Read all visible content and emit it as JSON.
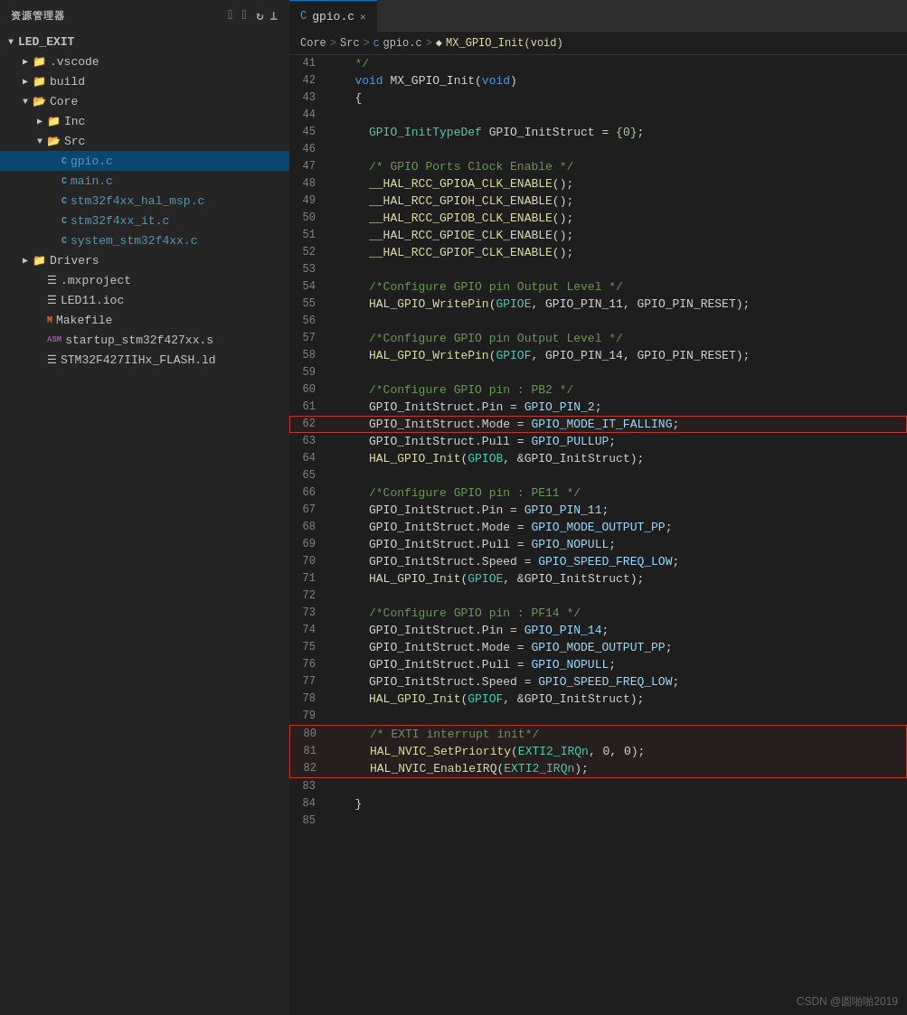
{
  "sidebar": {
    "header": "资源管理器",
    "icons": [
      "⊕",
      "⊟",
      "↻",
      "⊡"
    ],
    "root": "LED_EXIT",
    "items": [
      {
        "id": "vscode",
        "label": ".vscode",
        "type": "folder",
        "depth": 1,
        "open": false
      },
      {
        "id": "build",
        "label": "build",
        "type": "folder",
        "depth": 1,
        "open": false
      },
      {
        "id": "core",
        "label": "Core",
        "type": "folder",
        "depth": 1,
        "open": true
      },
      {
        "id": "inc",
        "label": "Inc",
        "type": "folder",
        "depth": 2,
        "open": false
      },
      {
        "id": "src",
        "label": "Src",
        "type": "folder",
        "depth": 2,
        "open": true
      },
      {
        "id": "gpio",
        "label": "gpio.c",
        "type": "c",
        "depth": 3,
        "active": true
      },
      {
        "id": "main",
        "label": "main.c",
        "type": "c",
        "depth": 3
      },
      {
        "id": "stm32f4xx_hal_msp",
        "label": "stm32f4xx_hal_msp.c",
        "type": "c",
        "depth": 3
      },
      {
        "id": "stm32f4xx_it",
        "label": "stm32f4xx_it.c",
        "type": "c",
        "depth": 3
      },
      {
        "id": "system_stm32f4xx",
        "label": "system_stm32f4xx.c",
        "type": "c",
        "depth": 3
      },
      {
        "id": "drivers",
        "label": "Drivers",
        "type": "folder",
        "depth": 1,
        "open": false
      },
      {
        "id": "mxproject",
        "label": ".mxproject",
        "type": "file",
        "depth": 1
      },
      {
        "id": "led11ioc",
        "label": "LED11.ioc",
        "type": "file",
        "depth": 1
      },
      {
        "id": "makefile",
        "label": "Makefile",
        "type": "makefile",
        "depth": 1
      },
      {
        "id": "startup",
        "label": "startup_stm32f427xx.s",
        "type": "asm",
        "depth": 1
      },
      {
        "id": "stm32flash",
        "label": "STM32F427IIHx_FLASH.ld",
        "type": "ld",
        "depth": 1
      }
    ]
  },
  "tab": {
    "filename": "gpio.c",
    "icon": "C"
  },
  "breadcrumb": {
    "items": [
      "Core",
      "Src",
      "gpio.c",
      "MX_GPIO_Init(void)"
    ]
  },
  "watermark": "CSDN @圆啪啪2019",
  "code": {
    "lines": [
      {
        "n": 41,
        "tokens": [
          {
            "t": "   */",
            "c": "comment"
          }
        ]
      },
      {
        "n": 42,
        "tokens": [
          {
            "t": "   ",
            "c": "plain"
          },
          {
            "t": "void",
            "c": "kw"
          },
          {
            "t": " MX_GPIO_Init(",
            "c": "plain"
          },
          {
            "t": "void",
            "c": "kw"
          },
          {
            "t": ")",
            "c": "plain"
          }
        ]
      },
      {
        "n": 43,
        "tokens": [
          {
            "t": "   {",
            "c": "plain"
          }
        ]
      },
      {
        "n": 44,
        "tokens": []
      },
      {
        "n": 45,
        "tokens": [
          {
            "t": "     ",
            "c": "plain"
          },
          {
            "t": "GPIO_InitTypeDef",
            "c": "type"
          },
          {
            "t": " GPIO_InitStruct = ",
            "c": "plain"
          },
          {
            "t": "{0}",
            "c": "num"
          },
          {
            "t": ";",
            "c": "plain"
          }
        ]
      },
      {
        "n": 46,
        "tokens": []
      },
      {
        "n": 47,
        "tokens": [
          {
            "t": "     ",
            "c": "comment"
          },
          {
            "t": "/* GPIO Ports Clock Enable */",
            "c": "comment"
          }
        ]
      },
      {
        "n": 48,
        "tokens": [
          {
            "t": "     __HAL_RCC_GPIOA_CLK_ENABLE",
            "c": "fn"
          },
          {
            "t": "();",
            "c": "plain"
          }
        ]
      },
      {
        "n": 49,
        "tokens": [
          {
            "t": "     __HAL_RCC_GPIOH_CLK_ENABLE",
            "c": "fn"
          },
          {
            "t": "();",
            "c": "plain"
          }
        ]
      },
      {
        "n": 50,
        "tokens": [
          {
            "t": "     __HAL_RCC_GPIOB_CLK_ENABLE",
            "c": "fn"
          },
          {
            "t": "();",
            "c": "plain"
          }
        ]
      },
      {
        "n": 51,
        "tokens": [
          {
            "t": "     __HAL_RCC_GPIOE_CLK_ENABLE",
            "c": "fn"
          },
          {
            "t": "();",
            "c": "plain"
          }
        ]
      },
      {
        "n": 52,
        "tokens": [
          {
            "t": "     __HAL_RCC_GPIOF_CLK_ENABLE",
            "c": "fn"
          },
          {
            "t": "();",
            "c": "plain"
          }
        ]
      },
      {
        "n": 53,
        "tokens": []
      },
      {
        "n": 54,
        "tokens": [
          {
            "t": "     ",
            "c": "comment"
          },
          {
            "t": "/*Configure GPIO pin Output Level */",
            "c": "comment"
          }
        ]
      },
      {
        "n": 55,
        "tokens": [
          {
            "t": "     ",
            "c": "plain"
          },
          {
            "t": "HAL_GPIO_WritePin",
            "c": "fn"
          },
          {
            "t": "(",
            "c": "plain"
          },
          {
            "t": "GPIOE",
            "c": "cyan-id"
          },
          {
            "t": ", GPIO_PIN_11, GPIO_PIN_RESET);",
            "c": "plain"
          }
        ]
      },
      {
        "n": 56,
        "tokens": []
      },
      {
        "n": 57,
        "tokens": [
          {
            "t": "     ",
            "c": "comment"
          },
          {
            "t": "/*Configure GPIO pin Output Level */",
            "c": "comment"
          }
        ]
      },
      {
        "n": 58,
        "tokens": [
          {
            "t": "     ",
            "c": "plain"
          },
          {
            "t": "HAL_GPIO_WritePin",
            "c": "fn"
          },
          {
            "t": "(",
            "c": "plain"
          },
          {
            "t": "GPIOF",
            "c": "cyan-id"
          },
          {
            "t": ", GPIO_PIN_14, GPIO_PIN_RESET);",
            "c": "plain"
          }
        ]
      },
      {
        "n": 59,
        "tokens": []
      },
      {
        "n": 60,
        "tokens": [
          {
            "t": "     ",
            "c": "comment"
          },
          {
            "t": "/*Configure GPIO pin : PB2 */",
            "c": "comment"
          }
        ]
      },
      {
        "n": 61,
        "tokens": [
          {
            "t": "     GPIO_InitStruct.Pin = ",
            "c": "plain"
          },
          {
            "t": "GPIO_PIN_2",
            "c": "light-blue"
          },
          {
            "t": ";",
            "c": "plain"
          }
        ]
      },
      {
        "n": 62,
        "tokens": [
          {
            "t": "     GPIO_InitStruct.Mode = ",
            "c": "plain"
          },
          {
            "t": "GPIO_MODE_IT_FALLING",
            "c": "light-blue"
          },
          {
            "t": ";",
            "c": "plain"
          }
        ],
        "highlight": true
      },
      {
        "n": 63,
        "tokens": [
          {
            "t": "     GPIO_InitStruct.Pull = ",
            "c": "plain"
          },
          {
            "t": "GPIO_PULLUP",
            "c": "light-blue"
          },
          {
            "t": ";",
            "c": "plain"
          }
        ]
      },
      {
        "n": 64,
        "tokens": [
          {
            "t": "     ",
            "c": "plain"
          },
          {
            "t": "HAL_GPIO_Init",
            "c": "fn"
          },
          {
            "t": "(",
            "c": "plain"
          },
          {
            "t": "GPIOB",
            "c": "cyan-id"
          },
          {
            "t": ", &GPIO_InitStruct);",
            "c": "plain"
          }
        ]
      },
      {
        "n": 65,
        "tokens": []
      },
      {
        "n": 66,
        "tokens": [
          {
            "t": "     ",
            "c": "comment"
          },
          {
            "t": "/*Configure GPIO pin : PE11 */",
            "c": "comment"
          }
        ]
      },
      {
        "n": 67,
        "tokens": [
          {
            "t": "     GPIO_InitStruct.Pin = ",
            "c": "plain"
          },
          {
            "t": "GPIO_PIN_11",
            "c": "light-blue"
          },
          {
            "t": ";",
            "c": "plain"
          }
        ]
      },
      {
        "n": 68,
        "tokens": [
          {
            "t": "     GPIO_InitStruct.Mode = ",
            "c": "plain"
          },
          {
            "t": "GPIO_MODE_OUTPUT_PP",
            "c": "light-blue"
          },
          {
            "t": ";",
            "c": "plain"
          }
        ]
      },
      {
        "n": 69,
        "tokens": [
          {
            "t": "     GPIO_InitStruct.Pull = ",
            "c": "plain"
          },
          {
            "t": "GPIO_NOPULL",
            "c": "light-blue"
          },
          {
            "t": ";",
            "c": "plain"
          }
        ]
      },
      {
        "n": 70,
        "tokens": [
          {
            "t": "     GPIO_InitStruct.Speed = ",
            "c": "plain"
          },
          {
            "t": "GPIO_SPEED_FREQ_LOW",
            "c": "light-blue"
          },
          {
            "t": ";",
            "c": "plain"
          }
        ]
      },
      {
        "n": 71,
        "tokens": [
          {
            "t": "     ",
            "c": "plain"
          },
          {
            "t": "HAL_GPIO_Init",
            "c": "fn"
          },
          {
            "t": "(",
            "c": "plain"
          },
          {
            "t": "GPIOE",
            "c": "cyan-id"
          },
          {
            "t": ", &GPIO_InitStruct);",
            "c": "plain"
          }
        ]
      },
      {
        "n": 72,
        "tokens": []
      },
      {
        "n": 73,
        "tokens": [
          {
            "t": "     ",
            "c": "comment"
          },
          {
            "t": "/*Configure GPIO pin : PF14 */",
            "c": "comment"
          }
        ]
      },
      {
        "n": 74,
        "tokens": [
          {
            "t": "     GPIO_InitStruct.Pin = ",
            "c": "plain"
          },
          {
            "t": "GPIO_PIN_14",
            "c": "light-blue"
          },
          {
            "t": ";",
            "c": "plain"
          }
        ]
      },
      {
        "n": 75,
        "tokens": [
          {
            "t": "     GPIO_InitStruct.Mode = ",
            "c": "plain"
          },
          {
            "t": "GPIO_MODE_OUTPUT_PP",
            "c": "light-blue"
          },
          {
            "t": ";",
            "c": "plain"
          }
        ]
      },
      {
        "n": 76,
        "tokens": [
          {
            "t": "     GPIO_InitStruct.Pull = ",
            "c": "plain"
          },
          {
            "t": "GPIO_NOPULL",
            "c": "light-blue"
          },
          {
            "t": ";",
            "c": "plain"
          }
        ]
      },
      {
        "n": 77,
        "tokens": [
          {
            "t": "     GPIO_InitStruct.Speed = ",
            "c": "plain"
          },
          {
            "t": "GPIO_SPEED_FREQ_LOW",
            "c": "light-blue"
          },
          {
            "t": ";",
            "c": "plain"
          }
        ]
      },
      {
        "n": 78,
        "tokens": [
          {
            "t": "     ",
            "c": "plain"
          },
          {
            "t": "HAL_GPIO_Init",
            "c": "fn"
          },
          {
            "t": "(",
            "c": "plain"
          },
          {
            "t": "GPIOF",
            "c": "cyan-id"
          },
          {
            "t": ", &GPIO_InitStruct);",
            "c": "plain"
          }
        ]
      },
      {
        "n": 79,
        "tokens": []
      },
      {
        "n": 80,
        "tokens": [
          {
            "t": "     ",
            "c": "comment"
          },
          {
            "t": "/* EXTI interrupt init*/",
            "c": "comment"
          }
        ],
        "highlight_group_start": true
      },
      {
        "n": 81,
        "tokens": [
          {
            "t": "     ",
            "c": "plain"
          },
          {
            "t": "HAL_NVIC_SetPriority",
            "c": "fn"
          },
          {
            "t": "(",
            "c": "plain"
          },
          {
            "t": "EXTI2_IRQn",
            "c": "cyan-id"
          },
          {
            "t": ", 0, 0);",
            "c": "plain"
          }
        ],
        "highlight_group": true
      },
      {
        "n": 82,
        "tokens": [
          {
            "t": "     ",
            "c": "plain"
          },
          {
            "t": "HAL_NVIC_EnableIRQ",
            "c": "fn"
          },
          {
            "t": "(",
            "c": "plain"
          },
          {
            "t": "EXTI2_IRQn",
            "c": "cyan-id"
          },
          {
            "t": ");",
            "c": "plain"
          }
        ],
        "highlight_group_end": true
      },
      {
        "n": 83,
        "tokens": []
      },
      {
        "n": 84,
        "tokens": [
          {
            "t": "   }",
            "c": "plain"
          }
        ]
      },
      {
        "n": 85,
        "tokens": []
      }
    ]
  }
}
